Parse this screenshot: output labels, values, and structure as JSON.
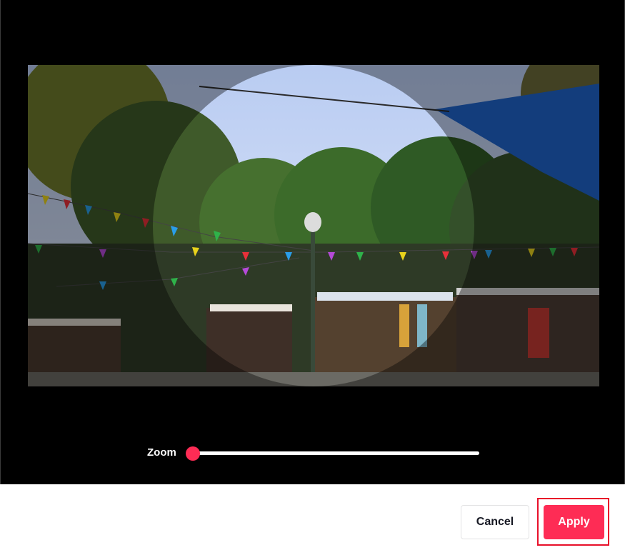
{
  "crop": {
    "zoom_label": "Zoom",
    "zoom_level_fraction": 0.0
  },
  "footer": {
    "cancel_label": "Cancel",
    "apply_label": "Apply"
  },
  "colors": {
    "accent": "#fe2c55",
    "highlight_outline": "#e8102a",
    "crop_background": "#000000"
  }
}
